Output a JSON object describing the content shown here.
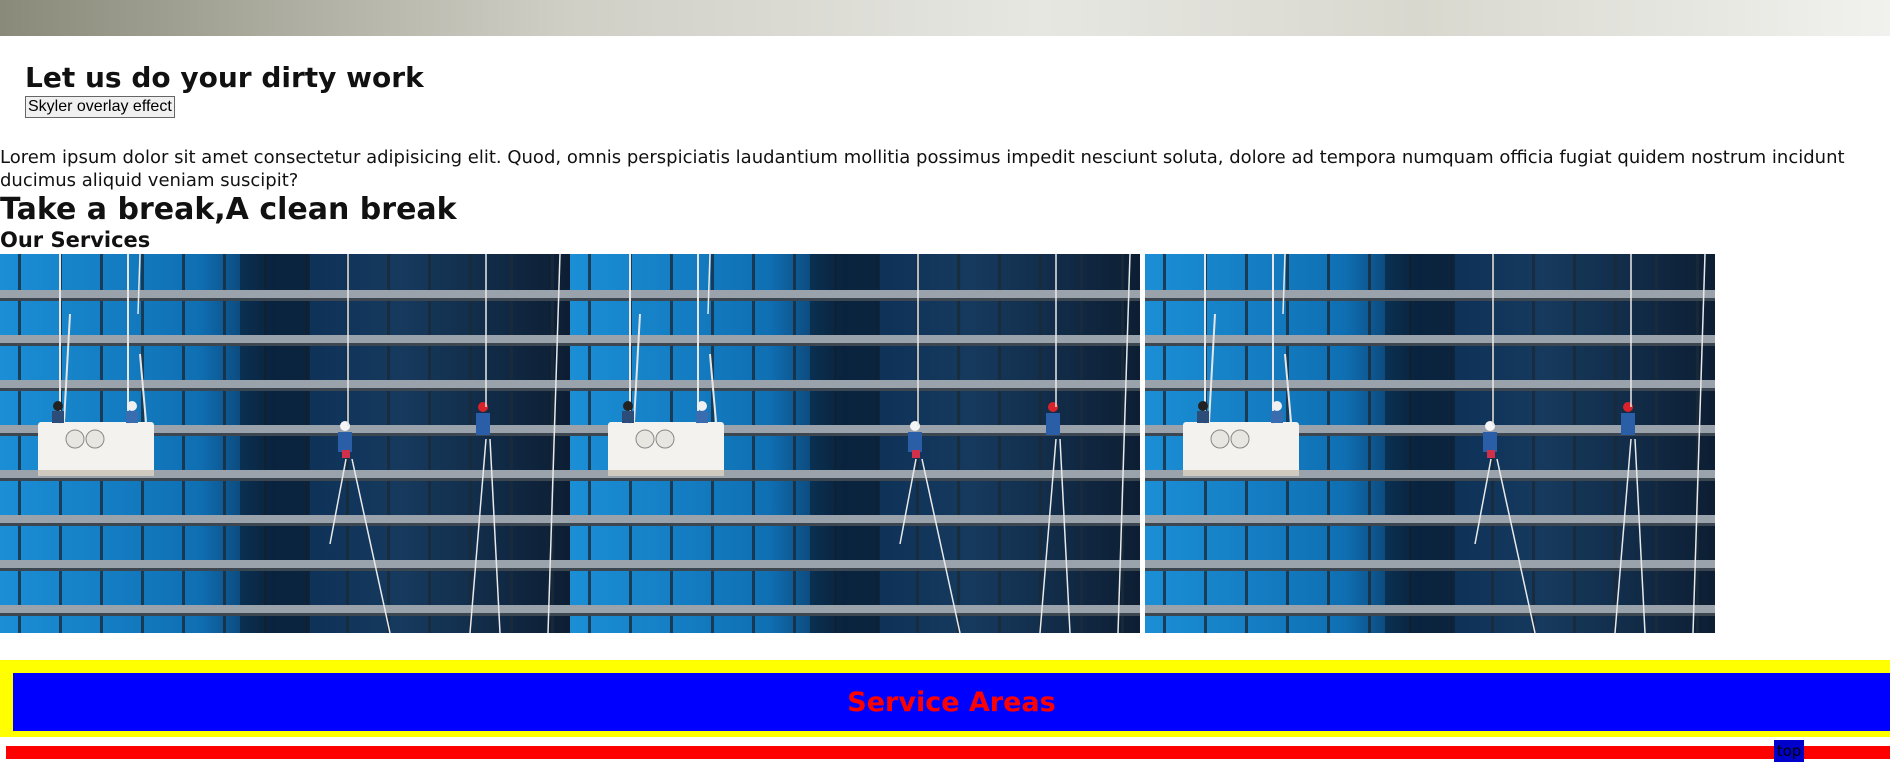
{
  "hero": {
    "title": "Let us do your dirty work",
    "button_label": "Skyler overlay effect"
  },
  "intro_text": "Lorem ipsum dolor sit amet consectetur adipisicing elit. Quod, omnis perspiciatis laudantium mollitia possimus impedit nesciunt soluta, dolore ad tempora numquam officia fugiat quidem nostrum incidunt ducimus aliquid veniam suscipit?",
  "tagline": "Take a break,A clean break",
  "services": {
    "title": "Our Services",
    "image_icon": "window-cleaners-photo"
  },
  "service_areas": {
    "label": "Service Areas",
    "colors": {
      "outer": "#ffff00",
      "inner": "#0000ff",
      "text": "#ff0000"
    }
  },
  "footer": {
    "top_link": "top",
    "bar_color": "#ff0000"
  }
}
